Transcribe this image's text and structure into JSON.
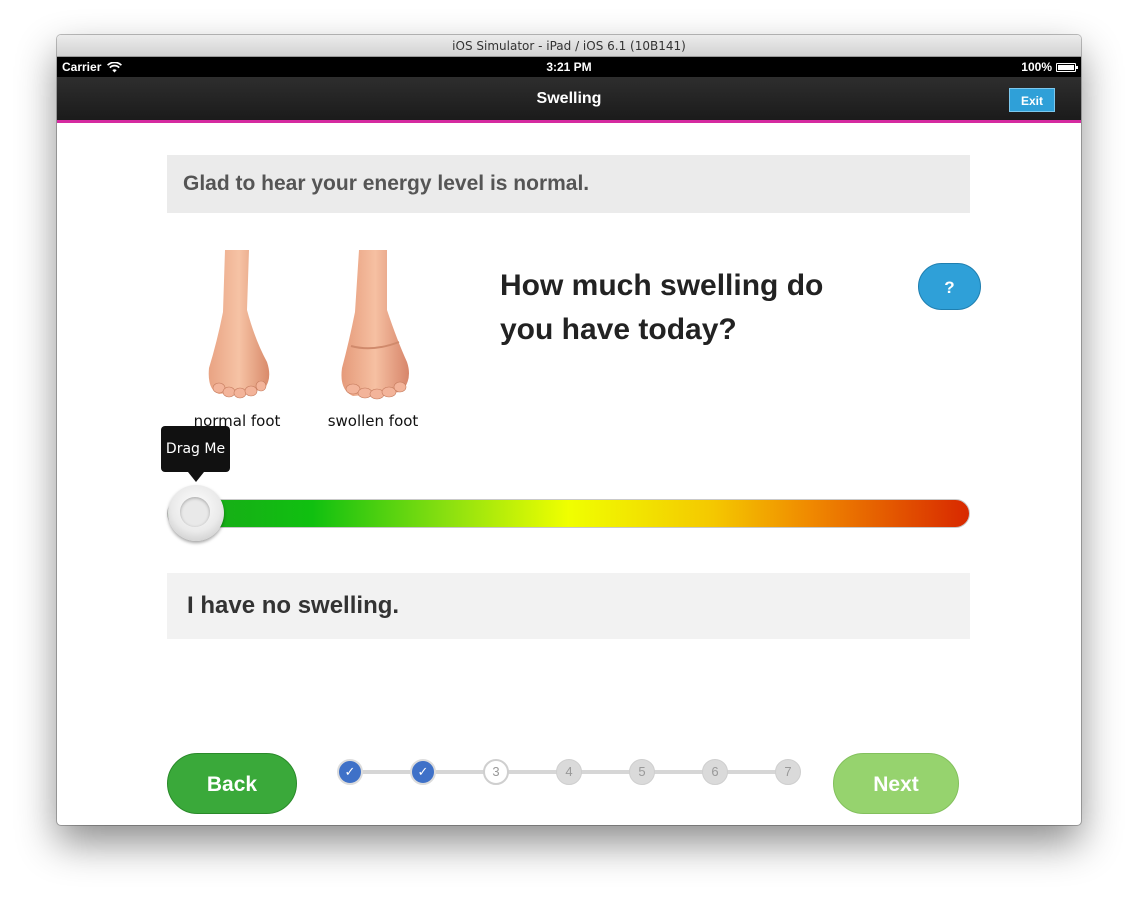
{
  "window": {
    "title": "iOS Simulator - iPad / iOS 6.1 (10B141)"
  },
  "status_bar": {
    "carrier": "Carrier",
    "time": "3:21 PM",
    "battery": "100%"
  },
  "nav": {
    "title": "Swelling",
    "exit_label": "Exit"
  },
  "banner": {
    "text": "Glad to hear your energy level is normal."
  },
  "images": {
    "normal_label": "normal foot",
    "swollen_label": "swollen foot"
  },
  "question": {
    "text": "How much swelling do you have today?",
    "help_label": "?"
  },
  "slider": {
    "tooltip": "Drag Me",
    "value": 0,
    "colors": [
      "#1aa51a",
      "#f0ff00",
      "#d82800"
    ]
  },
  "answer": {
    "text": "I have no swelling."
  },
  "footer": {
    "back_label": "Back",
    "next_label": "Next",
    "steps": [
      {
        "label": "✓",
        "state": "done"
      },
      {
        "label": "✓",
        "state": "done"
      },
      {
        "label": "3",
        "state": "current"
      },
      {
        "label": "4",
        "state": "pending"
      },
      {
        "label": "5",
        "state": "pending"
      },
      {
        "label": "6",
        "state": "pending"
      },
      {
        "label": "7",
        "state": "pending"
      }
    ]
  }
}
